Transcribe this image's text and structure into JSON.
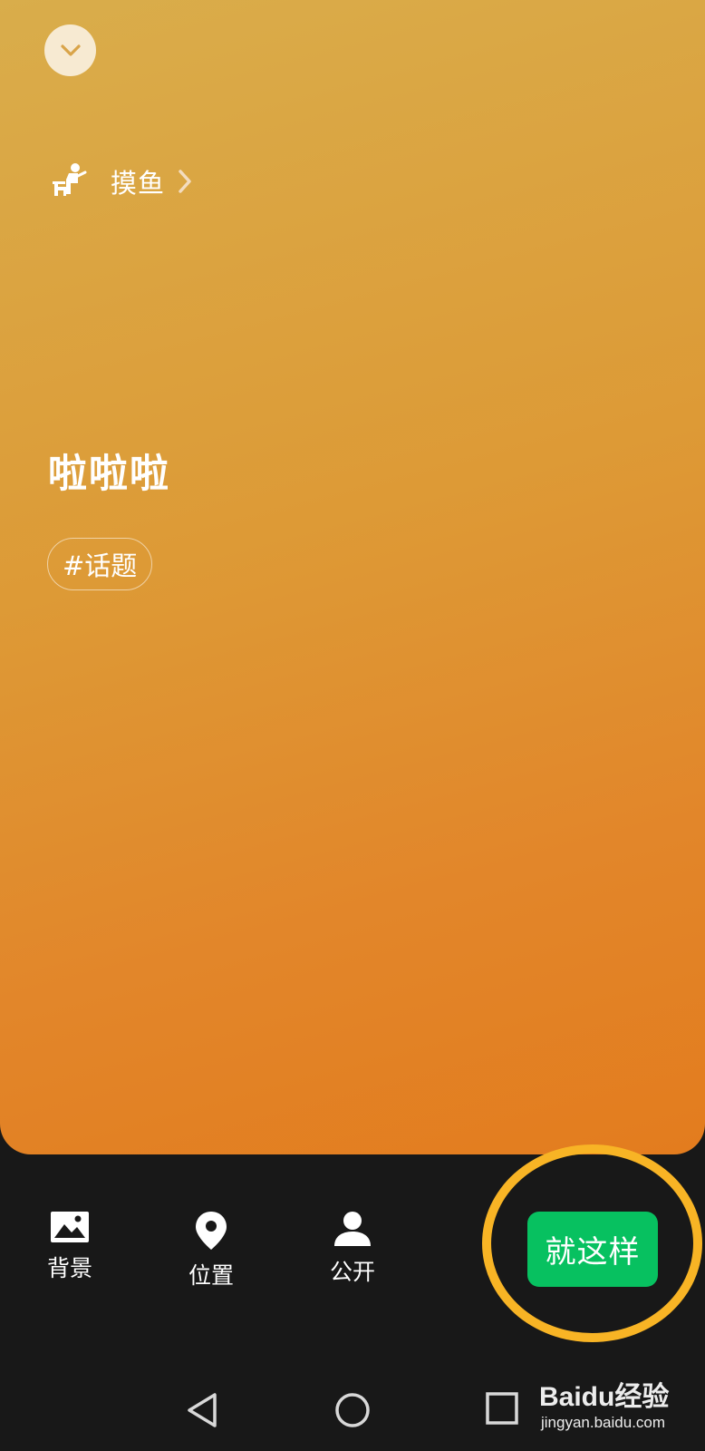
{
  "status": {
    "label": "摸鱼",
    "icon": "person-at-desk-icon"
  },
  "post": {
    "text": "啦啦啦",
    "topic": "#话题"
  },
  "toolbar": {
    "items": [
      {
        "label": "背景",
        "icon": "image-icon"
      },
      {
        "label": "位置",
        "icon": "location-pin-icon"
      },
      {
        "label": "公开",
        "icon": "person-icon"
      }
    ],
    "confirm_label": "就这样"
  },
  "watermark": {
    "brand": "Baidu经验",
    "url": "jingyan.baidu.com"
  },
  "colors": {
    "card_gradient_start": "#d9ad4b",
    "card_gradient_end": "#e37c1e",
    "confirm_button": "#07c160",
    "highlight_ring": "#f8b425",
    "bottom_background": "#181818"
  }
}
